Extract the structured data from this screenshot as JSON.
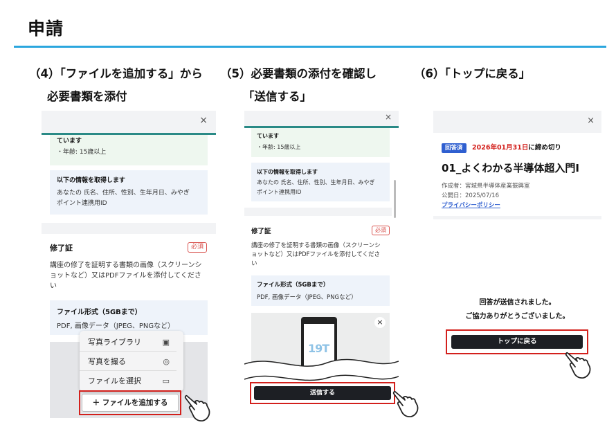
{
  "page_title": "申請",
  "step4": {
    "heading_line1": "（4）「ファイルを追加する」から",
    "heading_line2": "必要書類を添付",
    "close": "×",
    "green_title": "ています",
    "green_item": "・年齢: 15歳以上",
    "info_title": "以下の情報を取得します",
    "info_body_1": "あなたの 氏名、住所、性別、生年月日、みやぎ",
    "info_body_2": "ポイント連携用ID",
    "cert_title": "修了証",
    "required_badge": "必須",
    "cert_desc_1": "講座の修了を証明する書類の画像（スクリーンシ",
    "cert_desc_2": "ョットなど）又はPDFファイルを添付してくださ",
    "cert_desc_3": "い",
    "format_title": "ファイル形式（5GBまで）",
    "format_body": "PDF, 画像データ（JPEG、PNGなど）",
    "menu": [
      "写真ライブラリ",
      "写真を撮る",
      "ファイルを選択"
    ],
    "add_file_button": "＋ ファイルを追加する"
  },
  "step5": {
    "heading_line1": "（5）必要書類の添付を確認し",
    "heading_line2": "「送信する」",
    "close": "×",
    "green_title": "ています",
    "green_item": "・年齢: 15歳以上",
    "info_title": "以下の情報を取得します",
    "info_body_1": "あなたの 氏名、住所、性別、生年月日、みやぎ",
    "info_body_2": "ポイント連携用ID",
    "cert_title": "修了証",
    "required_badge": "必須",
    "cert_desc_1": "講座の修了を証明する書類の画像（スクリーンシ",
    "cert_desc_2": "ョットなど）又はPDFファイルを添付してくださ",
    "cert_desc_3": "い",
    "format_title": "ファイル形式（5GBまで）",
    "format_body": "PDF, 画像データ（JPEG、PNGなど）",
    "thumb_close": "×",
    "thumb_text": "19T",
    "submit_button": "送信する"
  },
  "step6": {
    "heading_line1": "（6）「トップに戻る」",
    "close": "×",
    "status_badge": "回答済",
    "deadline_date": "2026年01月31日",
    "deadline_suffix": "に締め切り",
    "form_title": "01_よくわかる半導体超入門Ⅰ",
    "author": "作成者：宮城県半導体産業振興室",
    "published": "公開日：2025/07/16",
    "privacy_link": "プライバシーポリシー",
    "sent_message": "回答が送信されました。",
    "thanks_message": "ご協力ありがとうございました。",
    "back_button": "トップに戻る"
  }
}
